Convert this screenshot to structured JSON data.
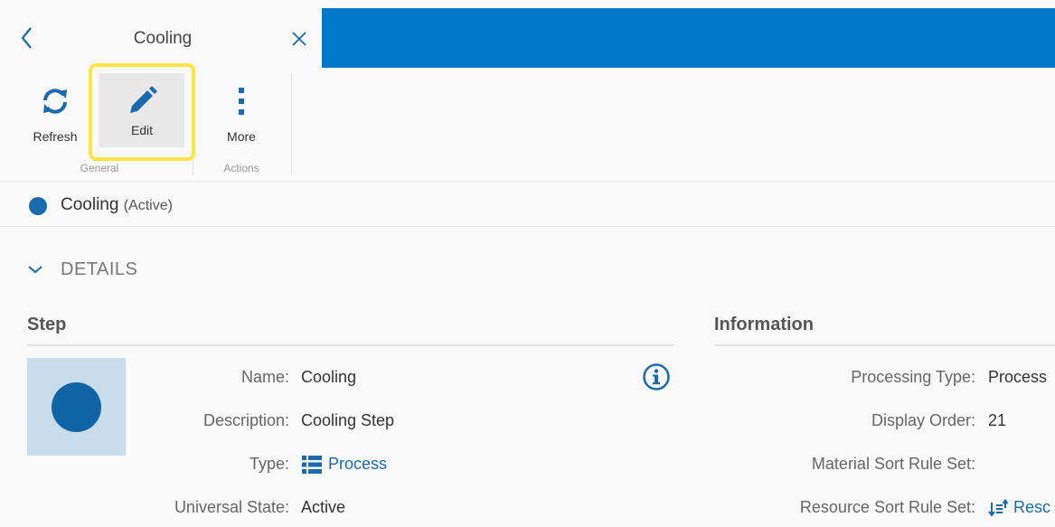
{
  "tab": {
    "title": "Cooling"
  },
  "toolbar": {
    "refresh_label": "Refresh",
    "edit_label": "Edit",
    "more_label": "More",
    "group_general": "General",
    "group_actions": "Actions"
  },
  "status": {
    "name": "Cooling",
    "state": "(Active)"
  },
  "details": {
    "title": "DETAILS"
  },
  "step": {
    "section_title": "Step",
    "name_label": "Name:",
    "name_value": "Cooling",
    "description_label": "Description:",
    "description_value": "Cooling Step",
    "type_label": "Type:",
    "type_value": "Process",
    "universal_state_label": "Universal State:",
    "universal_state_value": "Active"
  },
  "information": {
    "section_title": "Information",
    "processing_type_label": "Processing Type:",
    "processing_type_value": "Process",
    "display_order_label": "Display Order:",
    "display_order_value": "21",
    "material_sort_label": "Material Sort Rule Set:",
    "material_sort_value": "",
    "resource_sort_label": "Resource Sort Rule Set:",
    "resource_sort_value": "Resc"
  },
  "colors": {
    "banner": "#0077c8",
    "accent_blue": "#1a6aad",
    "highlight": "#fde542"
  },
  "icons": {
    "back": "chevron-left-icon",
    "close": "close-icon",
    "refresh": "refresh-icon",
    "edit": "pencil-icon",
    "more": "vertical-dots-icon",
    "details_toggle": "chevron-down-icon",
    "info": "info-circle-icon",
    "type": "list-icon",
    "resource_sort": "sort-icon"
  }
}
